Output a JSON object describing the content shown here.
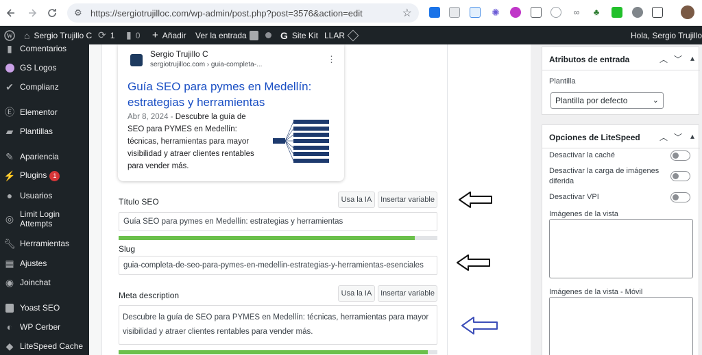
{
  "browser": {
    "url": "https://sergiotrujilloc.com/wp-admin/post.php?post=3576&action=edit",
    "back_icon": "arrow-left-icon",
    "forward_icon": "arrow-right-icon",
    "reload_icon": "reload-icon",
    "star_icon": "star-icon"
  },
  "admin_bar": {
    "site_name": "Sergio Trujillo C",
    "updates_count": "1",
    "comments_count": "0",
    "add_new": "Añadir",
    "view_entry": "Ver la entrada",
    "site_kit": "Site Kit",
    "llar": "LLAR",
    "greeting": "Hola, Sergio Trujillo"
  },
  "sidebar": {
    "items": [
      {
        "label": "Comentarios",
        "icon": "comment-icon"
      },
      {
        "label": "GS Logos",
        "icon": "gs-logos-icon"
      },
      {
        "label": "Complianz",
        "icon": "check-icon"
      },
      {
        "label": "Elementor",
        "icon": "elementor-icon"
      },
      {
        "label": "Plantillas",
        "icon": "folder-icon"
      },
      {
        "label": "Apariencia",
        "icon": "brush-icon"
      },
      {
        "label": "Plugins",
        "icon": "plug-icon",
        "badge": "1"
      },
      {
        "label": "Usuarios",
        "icon": "user-icon"
      },
      {
        "label": "Limit Login Attempts",
        "icon": "fingerprint-icon"
      },
      {
        "label": "Herramientas",
        "icon": "wrench-icon"
      },
      {
        "label": "Ajustes",
        "icon": "settings-icon"
      },
      {
        "label": "Joinchat",
        "icon": "chat-icon"
      },
      {
        "label": "Yoast SEO",
        "icon": "yoast-icon"
      },
      {
        "label": "WP Cerber",
        "icon": "cerber-icon"
      },
      {
        "label": "LiteSpeed Cache",
        "icon": "litespeed-icon"
      }
    ]
  },
  "serp_preview": {
    "site_name": "Sergio Trujillo C",
    "breadcrumb": "sergiotrujilloc.com › guia-completa-...",
    "title": "Guía SEO para pymes en Medellín: estrategias y herramientas",
    "date": "Abr 8, 2024",
    "separator": " - ",
    "description": "Descubre la guía de SEO para PYMES en Medellín: técnicas, herramientas para mayor visibilidad y atraer clientes rentables para vender más.",
    "menu_icon": "more-vertical-icon"
  },
  "seo_title": {
    "label": "Título SEO",
    "ai_button": "Usa la IA",
    "variable_button": "Insertar variable",
    "value": "Guía SEO para pymes en Medellín: estrategias y herramientas",
    "progress": 0.93
  },
  "slug": {
    "label": "Slug",
    "value": "guia-completa-de-seo-para-pymes-en-medellin-estrategias-y-herramientas-esenciales"
  },
  "meta_description": {
    "label": "Meta description",
    "ai_button": "Usa la IA",
    "variable_button": "Insertar variable",
    "value": "Descubre la guía de SEO para PYMES en Medellín: técnicas, herramientas para mayor visibilidad y atraer clientes rentables para vender más.",
    "progress": 0.97
  },
  "entry_attributes": {
    "title": "Atributos de entrada",
    "template_label": "Plantilla",
    "template_value": "Plantilla por defecto"
  },
  "litespeed": {
    "title": "Opciones de LiteSpeed",
    "disable_cache": "Desactivar la caché",
    "disable_lazy": "Desactivar la carga de imágenes diferida",
    "disable_vpi": "Desactivar VPI",
    "view_images": "Imágenes de la vista",
    "view_images_mobile": "Imágenes de la vista - Móvil"
  },
  "colors": {
    "admin_bar": "#1d2327",
    "link_blue": "#1a4fc4",
    "progress_green": "#6bc04b",
    "arrow_blue": "#3b4db8"
  }
}
